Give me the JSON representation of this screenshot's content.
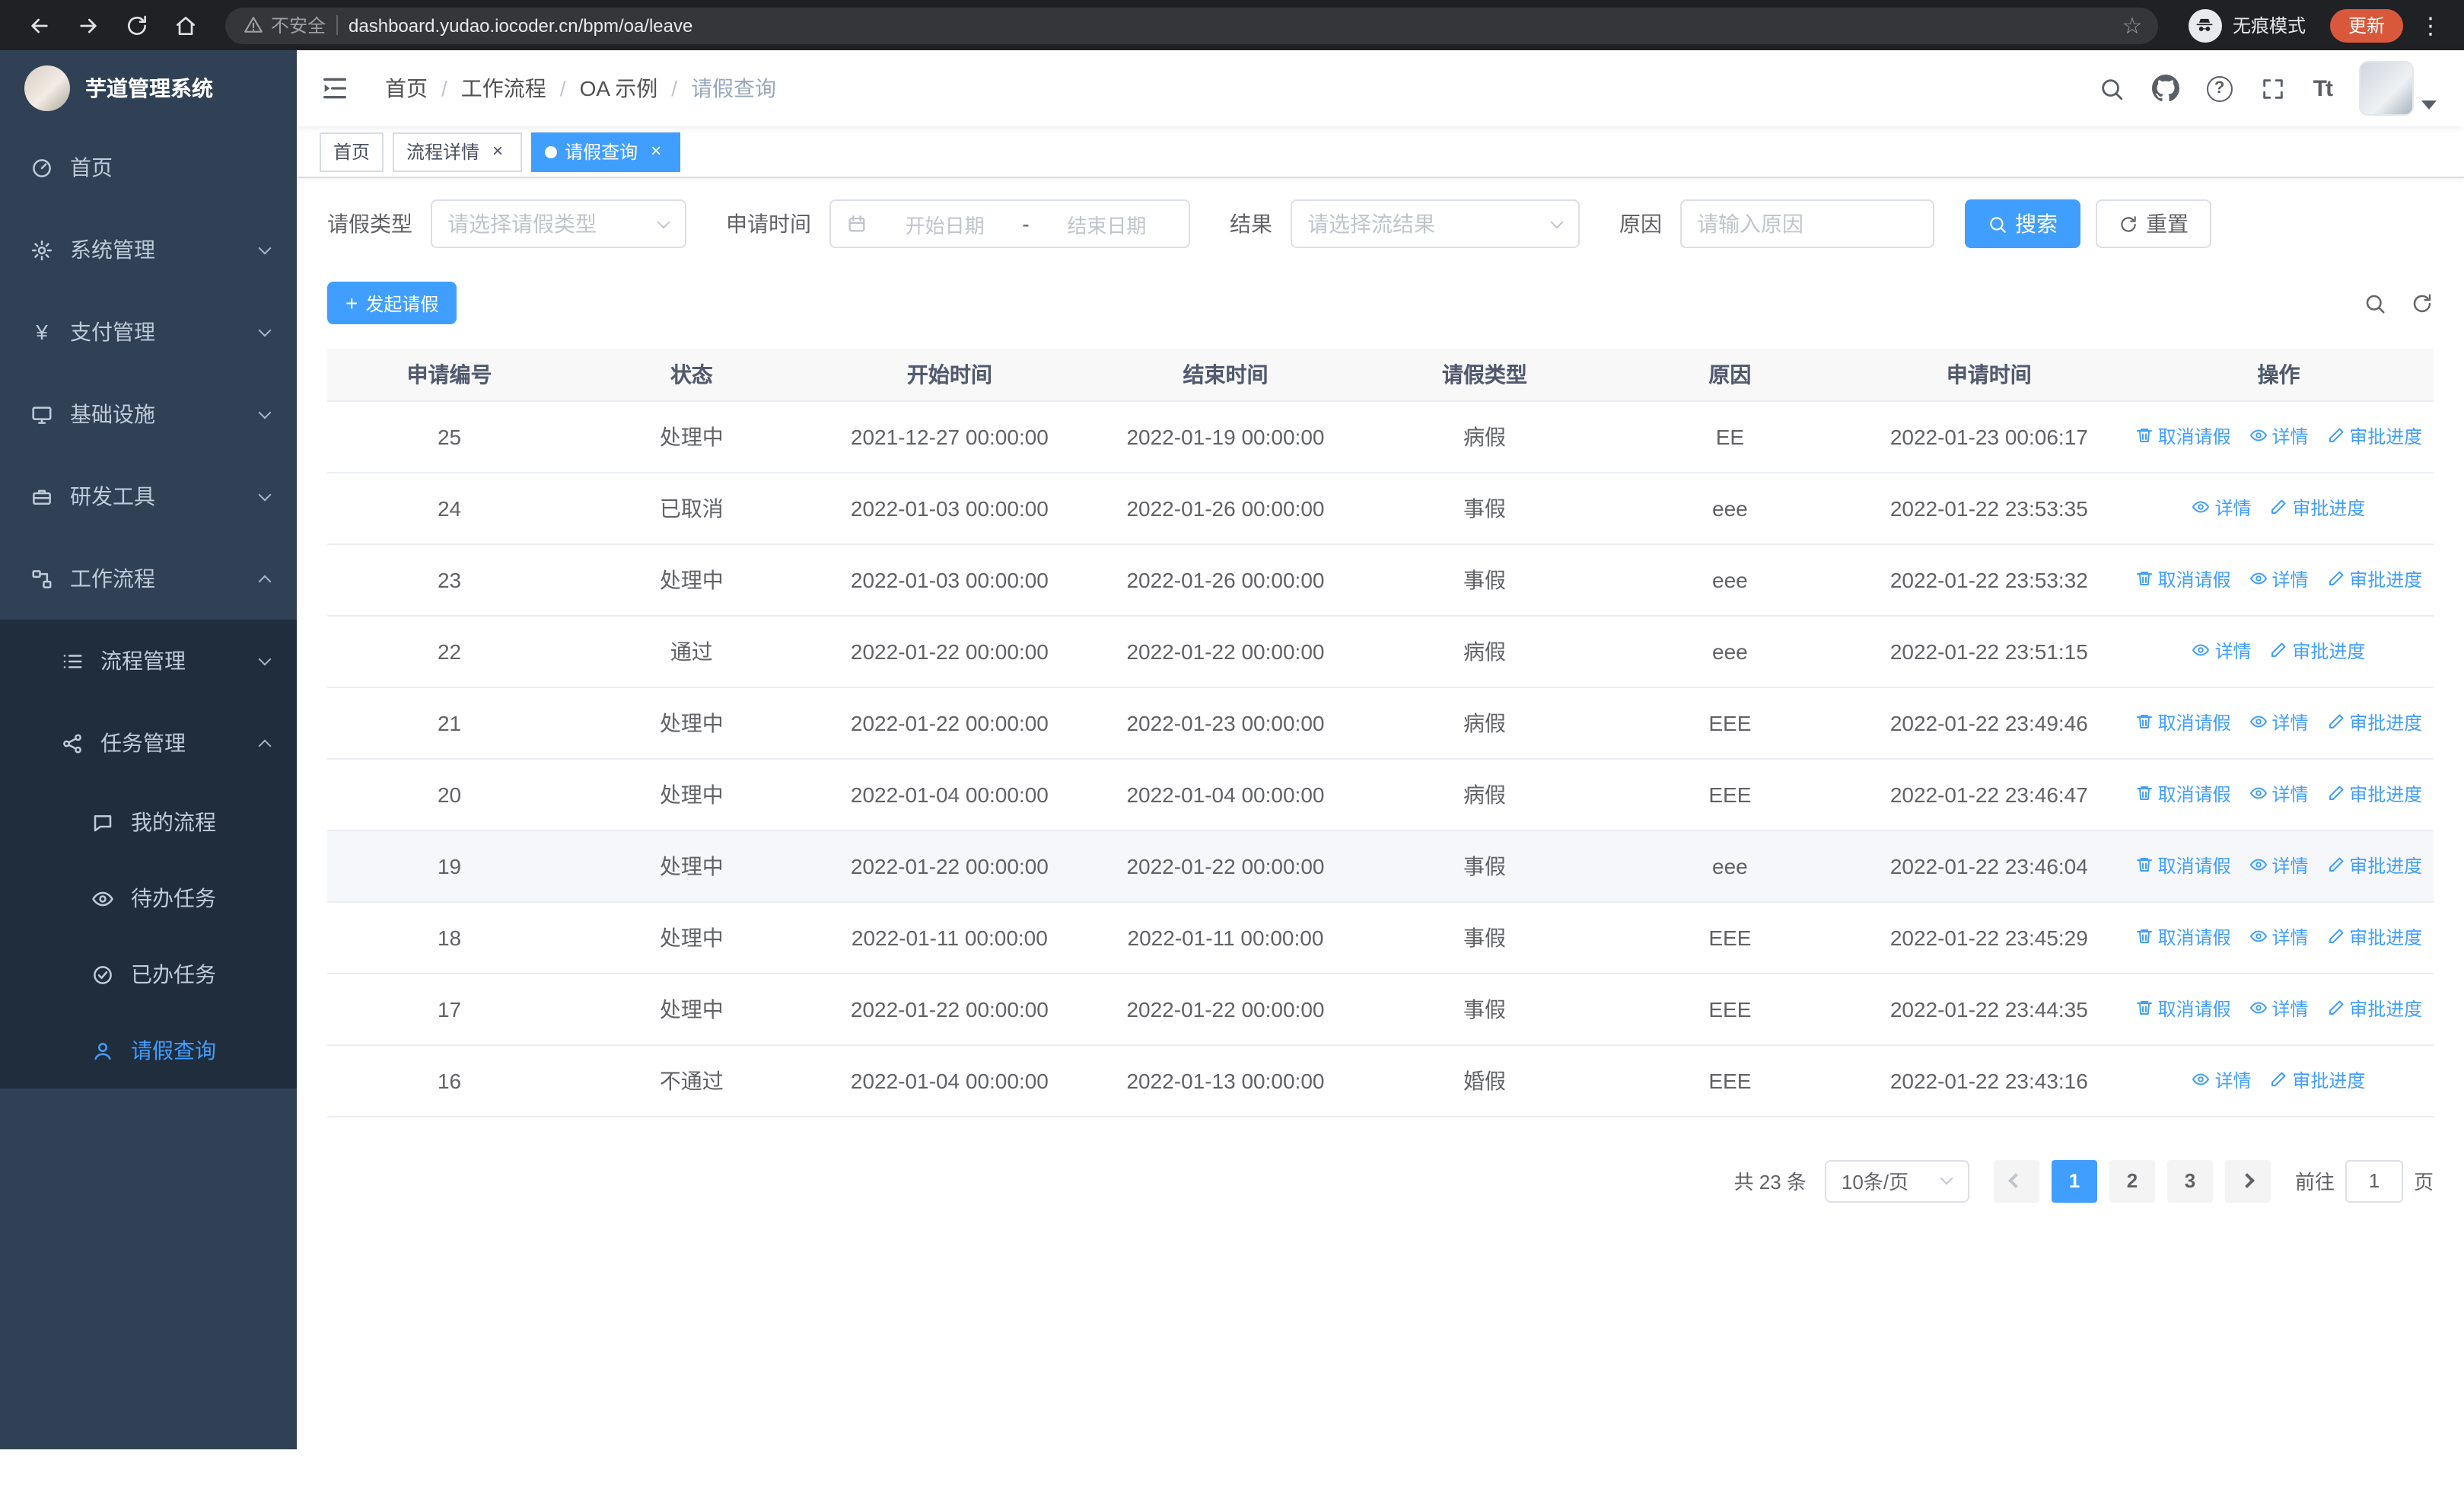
{
  "browser": {
    "security_warning": "不安全",
    "url": "dashboard.yudao.iocoder.cn/bpm/oa/leave",
    "incognito_label": "无痕模式",
    "update_label": "更新"
  },
  "icons": {
    "star": "☆",
    "menu_dots": "⋮",
    "help": "?",
    "font_size": "Tt",
    "yen": "¥",
    "plus": "+",
    "close": "×"
  },
  "sidebar": {
    "logo_title": "芋道管理系统",
    "menu": [
      {
        "label": "首页"
      },
      {
        "label": "系统管理"
      },
      {
        "label": "支付管理"
      },
      {
        "label": "基础设施"
      },
      {
        "label": "研发工具"
      },
      {
        "label": "工作流程"
      },
      {
        "label": "流程管理"
      },
      {
        "label": "任务管理"
      },
      {
        "label": "我的流程"
      },
      {
        "label": "待办任务"
      },
      {
        "label": "已办任务"
      },
      {
        "label": "请假查询"
      }
    ]
  },
  "header": {
    "breadcrumb": [
      "首页",
      "工作流程",
      "OA 示例",
      "请假查询"
    ],
    "breadcrumb_separator": "/"
  },
  "tabs": [
    {
      "label": "首页"
    },
    {
      "label": "流程详情"
    },
    {
      "label": "请假查询"
    }
  ],
  "filters": {
    "leave_type_label": "请假类型",
    "leave_type_placeholder": "请选择请假类型",
    "apply_time_label": "申请时间",
    "start_date_placeholder": "开始日期",
    "date_separator": "-",
    "end_date_placeholder": "结束日期",
    "result_label": "结果",
    "result_placeholder": "请选择流结果",
    "reason_label": "原因",
    "reason_placeholder": "请输入原因",
    "search_button": "搜索",
    "reset_button": "重置"
  },
  "toolbar": {
    "create_button": "发起请假"
  },
  "table": {
    "columns": [
      "申请编号",
      "状态",
      "开始时间",
      "结束时间",
      "请假类型",
      "原因",
      "申请时间",
      "操作"
    ],
    "actions": {
      "cancel": "取消请假",
      "detail": "详情",
      "progress": "审批进度"
    },
    "rows": [
      {
        "id": "25",
        "status": "处理中",
        "start": "2021-12-27 00:00:00",
        "end": "2022-01-19 00:00:00",
        "type": "病假",
        "reason": "EE",
        "applied": "2022-01-23 00:06:17"
      },
      {
        "id": "24",
        "status": "已取消",
        "start": "2022-01-03 00:00:00",
        "end": "2022-01-26 00:00:00",
        "type": "事假",
        "reason": "eee",
        "applied": "2022-01-22 23:53:35"
      },
      {
        "id": "23",
        "status": "处理中",
        "start": "2022-01-03 00:00:00",
        "end": "2022-01-26 00:00:00",
        "type": "事假",
        "reason": "eee",
        "applied": "2022-01-22 23:53:32"
      },
      {
        "id": "22",
        "status": "通过",
        "start": "2022-01-22 00:00:00",
        "end": "2022-01-22 00:00:00",
        "type": "病假",
        "reason": "eee",
        "applied": "2022-01-22 23:51:15"
      },
      {
        "id": "21",
        "status": "处理中",
        "start": "2022-01-22 00:00:00",
        "end": "2022-01-23 00:00:00",
        "type": "病假",
        "reason": "EEE",
        "applied": "2022-01-22 23:49:46"
      },
      {
        "id": "20",
        "status": "处理中",
        "start": "2022-01-04 00:00:00",
        "end": "2022-01-04 00:00:00",
        "type": "病假",
        "reason": "EEE",
        "applied": "2022-01-22 23:46:47"
      },
      {
        "id": "19",
        "status": "处理中",
        "start": "2022-01-22 00:00:00",
        "end": "2022-01-22 00:00:00",
        "type": "事假",
        "reason": "eee",
        "applied": "2022-01-22 23:46:04"
      },
      {
        "id": "18",
        "status": "处理中",
        "start": "2022-01-11 00:00:00",
        "end": "2022-01-11 00:00:00",
        "type": "事假",
        "reason": "EEE",
        "applied": "2022-01-22 23:45:29"
      },
      {
        "id": "17",
        "status": "处理中",
        "start": "2022-01-22 00:00:00",
        "end": "2022-01-22 00:00:00",
        "type": "事假",
        "reason": "EEE",
        "applied": "2022-01-22 23:44:35"
      },
      {
        "id": "16",
        "status": "不通过",
        "start": "2022-01-04 00:00:00",
        "end": "2022-01-13 00:00:00",
        "type": "婚假",
        "reason": "EEE",
        "applied": "2022-01-22 23:43:16"
      }
    ]
  },
  "pagination": {
    "total_label": "共 23 条",
    "page_size": "10条/页",
    "pages": [
      "1",
      "2",
      "3"
    ],
    "goto_label": "前往",
    "goto_value": "1",
    "goto_suffix": "页"
  },
  "colors": {
    "accent": "#409EFF",
    "sidebar_bg": "#304156",
    "submenu_bg": "#1f2d3d",
    "table_header_bg": "#f8f8f9"
  }
}
